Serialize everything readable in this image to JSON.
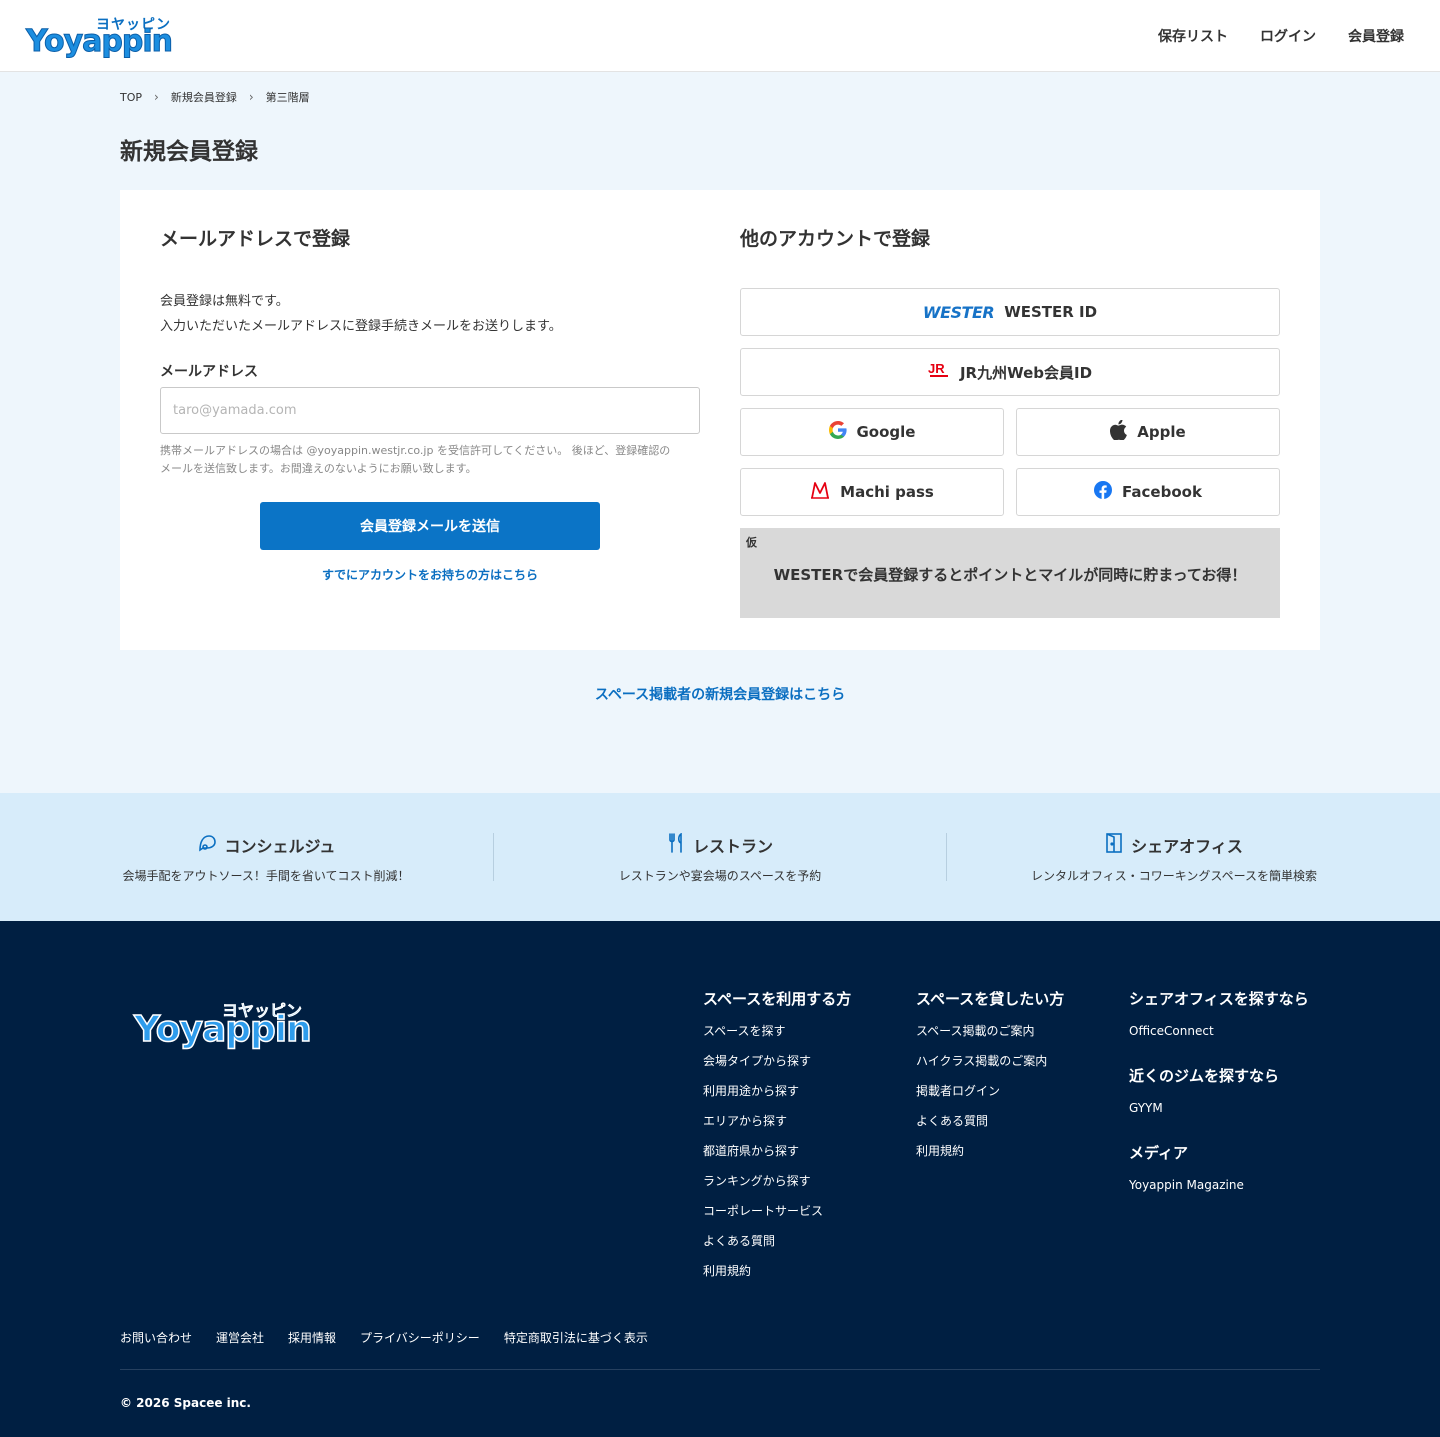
{
  "header": {
    "logo_kana": "ヨヤッピン",
    "logo_text": "Yoyappin",
    "nav": [
      "保存リスト",
      "ログイン",
      "会員登録"
    ]
  },
  "breadcrumb": [
    "TOP",
    "新規会員登録",
    "第三階層"
  ],
  "page_title": "新規会員登録",
  "email_section": {
    "title": "メールアドレスで登録",
    "intro_line1": "会員登録は無料です。",
    "intro_line2": "入力いただいたメールアドレスに登録手続きメールをお送りします。",
    "field_label": "メールアドレス",
    "placeholder": "taro@yamada.com",
    "value": "",
    "help_line1": "携帯メールアドレスの場合は @yoyappin.westjr.co.jp を受信許可してください。 後ほど、登録確認の",
    "help_line2": "メールを送信致します。お間違えのないようにお願い致します。",
    "submit_label": "会員登録メールを送信",
    "existing_link": "すでにアカウントをお持ちの方はこちら"
  },
  "other_section": {
    "title": "他のアカウントで登録",
    "wester_logo": "WESTER",
    "wester_label": "WESTER ID",
    "jr_label": "JR九州Web会員ID",
    "google_label": "Google",
    "apple_label": "Apple",
    "machi_label": "Machi pass",
    "facebook_label": "Facebook",
    "promo_tag": "仮",
    "promo_text": "WESTERで会員登録するとポイントとマイルが同時に貯まってお得！"
  },
  "host_link": "スペース掲載者の新規会員登録はこちら",
  "services": [
    {
      "title": "コンシェルジュ",
      "desc": "会場手配をアウトソース！手間を省いてコスト削減！",
      "icon": "concierge-icon"
    },
    {
      "title": "レストラン",
      "desc": "レストランや宴会場のスペースを予約",
      "icon": "restaurant-icon"
    },
    {
      "title": "シェアオフィス",
      "desc": "レンタルオフィス・コワーキングスペースを簡単検索",
      "icon": "office-icon"
    }
  ],
  "footer": {
    "logo_kana": "ヨヤッピン",
    "logo_text": "Yoyappin",
    "users": {
      "title": "スペースを利用する方",
      "links": [
        "スペースを探す",
        "会場タイプから探す",
        "利用用途から探す",
        "エリアから探す",
        "都道府県から探す",
        "ランキングから探す",
        "コーポレートサービス",
        "よくある質問",
        "利用規約"
      ]
    },
    "hosts": {
      "title": "スペースを貸したい方",
      "links": [
        "スペース掲載のご案内",
        "ハイクラス掲載のご案内",
        "掲載者ログイン",
        "よくある質問",
        "利用規約"
      ]
    },
    "office": {
      "title": "シェアオフィスを探すなら",
      "link": "OfficeConnect"
    },
    "gym": {
      "title": "近くのジムを探すなら",
      "link": "GYYM"
    },
    "media": {
      "title": "メディア",
      "link": "Yoyappin Magazine"
    },
    "bottom_links": [
      "お問い合わせ",
      "運営会社",
      "採用情報",
      "プライバシーポリシー",
      "特定商取引法に基づく表示"
    ],
    "copyright": "© 2026 Spacee inc."
  },
  "colors": {
    "accent": "#0b74c6",
    "link": "#0b6fc1",
    "footer_bg": "#001f42",
    "band_bg": "#d7ecfa",
    "page_bg": "#eef6fc"
  }
}
